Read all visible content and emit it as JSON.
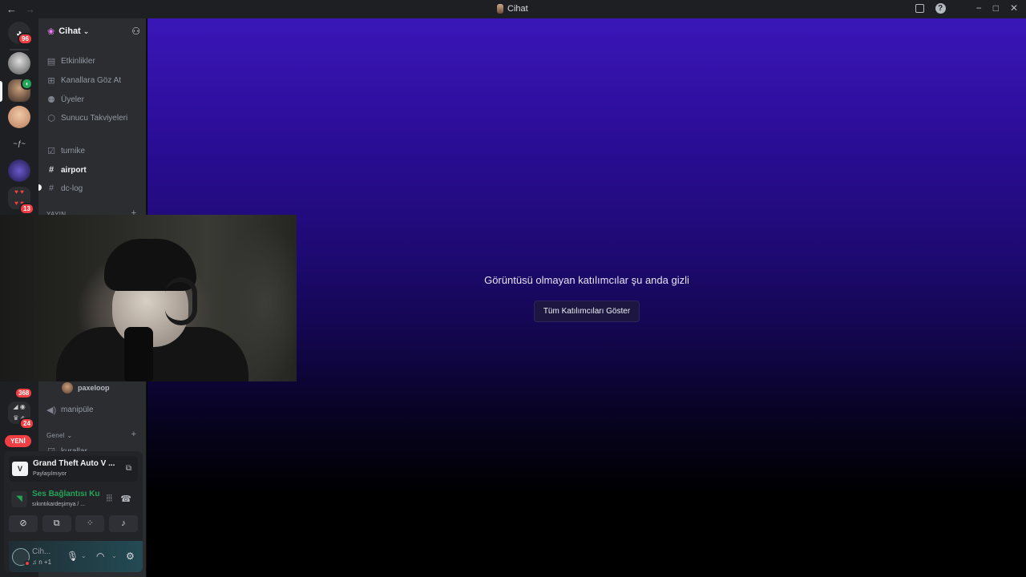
{
  "titlebar": {
    "back": "←",
    "forward": "→",
    "title": "Cihat",
    "minimize": "−",
    "maximize": "□",
    "close": "✕"
  },
  "rail": {
    "badges": {
      "dm": "96",
      "s7": "13",
      "s8": "368",
      "s9": "24"
    },
    "new_label": "YENİ"
  },
  "server": {
    "name": "Cihat"
  },
  "sidebar": {
    "top_items": [
      {
        "icon": "calendar-icon",
        "label": "Etkinlikler"
      },
      {
        "icon": "browse-channels-icon",
        "label": "Kanallara Göz At"
      },
      {
        "icon": "members-icon",
        "label": "Üyeler"
      },
      {
        "icon": "boost-icon",
        "label": "Sunucu Takviyeleri"
      }
    ],
    "channels": [
      {
        "icon": "rules-icon",
        "label": "turnike"
      },
      {
        "icon": "hash-icon",
        "label": "airport"
      },
      {
        "icon": "hash-icon",
        "label": "dc-log"
      }
    ],
    "category_yayin": "YAYIN",
    "voice_user": "paxeloop",
    "voice_channel": "manipüle",
    "category_genel": "Genel",
    "next_channel": "kurallar"
  },
  "activity": {
    "game": "Grand Theft Auto V ...",
    "game_status": "Paylaşılmıyor",
    "voice_title": "Ses Bağlantısı Ku",
    "voice_sub": "sıkıntıkardeşimya / ..."
  },
  "user": {
    "name": "Cih...",
    "status": "♫ n +1"
  },
  "stage": {
    "notice": "Görüntüsü olmayan katılımcılar şu anda gizli",
    "show_all": "Tüm Katılımcıları Göster"
  }
}
